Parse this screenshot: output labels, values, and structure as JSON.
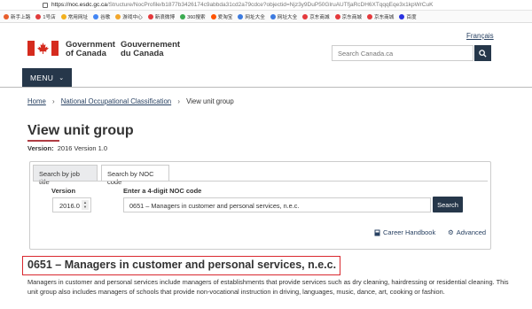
{
  "browser": {
    "url_host": "https://noc.esdc.gc.ca",
    "url_path": "/Structure/NocProfile/b1877b3426174c9abbda31cd2a79cdce?objectid=Njz3y9DuP50GlruAUTfjaRcDH6XTqqqEqe3x1kpWrCuK",
    "bookmarks": [
      "新手上路",
      "1号店",
      "常用网址",
      "谷歌",
      "游戏中心",
      "新浪微博",
      "360搜索",
      "爱淘宝",
      "网址大全",
      "网址大全",
      "京东商城",
      "京东商城",
      "京东商城",
      "百度"
    ],
    "bookmark_colors": [
      "#e85d2b",
      "#e03a3a",
      "#f2b01e",
      "#4285f4",
      "#f2a62b",
      "#e4393c",
      "#3cab51",
      "#ff5400",
      "#3c7be0",
      "#3c7be0",
      "#e4393c",
      "#e4393c",
      "#e4393c",
      "#2932e1"
    ]
  },
  "header": {
    "gov_en_line1": "Government",
    "gov_en_line2": "of Canada",
    "gov_fr_line1": "Gouvernement",
    "gov_fr_line2": "du Canada",
    "language_link": "Français",
    "search_placeholder": "Search Canada.ca",
    "search_icon": "search-icon",
    "menu_label": "MENU"
  },
  "breadcrumb": {
    "items": [
      "Home",
      "National Occupational Classification"
    ],
    "current": "View unit group"
  },
  "page": {
    "title": "View unit group",
    "version_label": "Version:",
    "version_value": "2016 Version 1.0"
  },
  "search_panel": {
    "tabs": [
      "Search by job title",
      "Search by NOC code"
    ],
    "version_label": "Version",
    "version_selected": "2016.0",
    "noc_label": "Enter a 4-digit NOC code",
    "noc_value": "0651 – Managers in customer and personal services, n.e.c.",
    "search_button": "Search",
    "career_handbook": "Career Handbook",
    "advanced": "Advanced"
  },
  "result": {
    "heading": "0651 – Managers in customer and personal services, n.e.c.",
    "description": "Managers in customer and personal services include managers of establishments that provide services such as dry cleaning, hairdressing or residential cleaning. This unit group also includes managers of schools that provide non-vocational instruction in driving, languages, music, dance, art, cooking or fashion."
  },
  "colors": {
    "brand_dark": "#26374a",
    "link": "#284162",
    "flag_red": "#d52b1e",
    "highlight_box": "#d9282f",
    "title_rule": "#af3c43"
  }
}
